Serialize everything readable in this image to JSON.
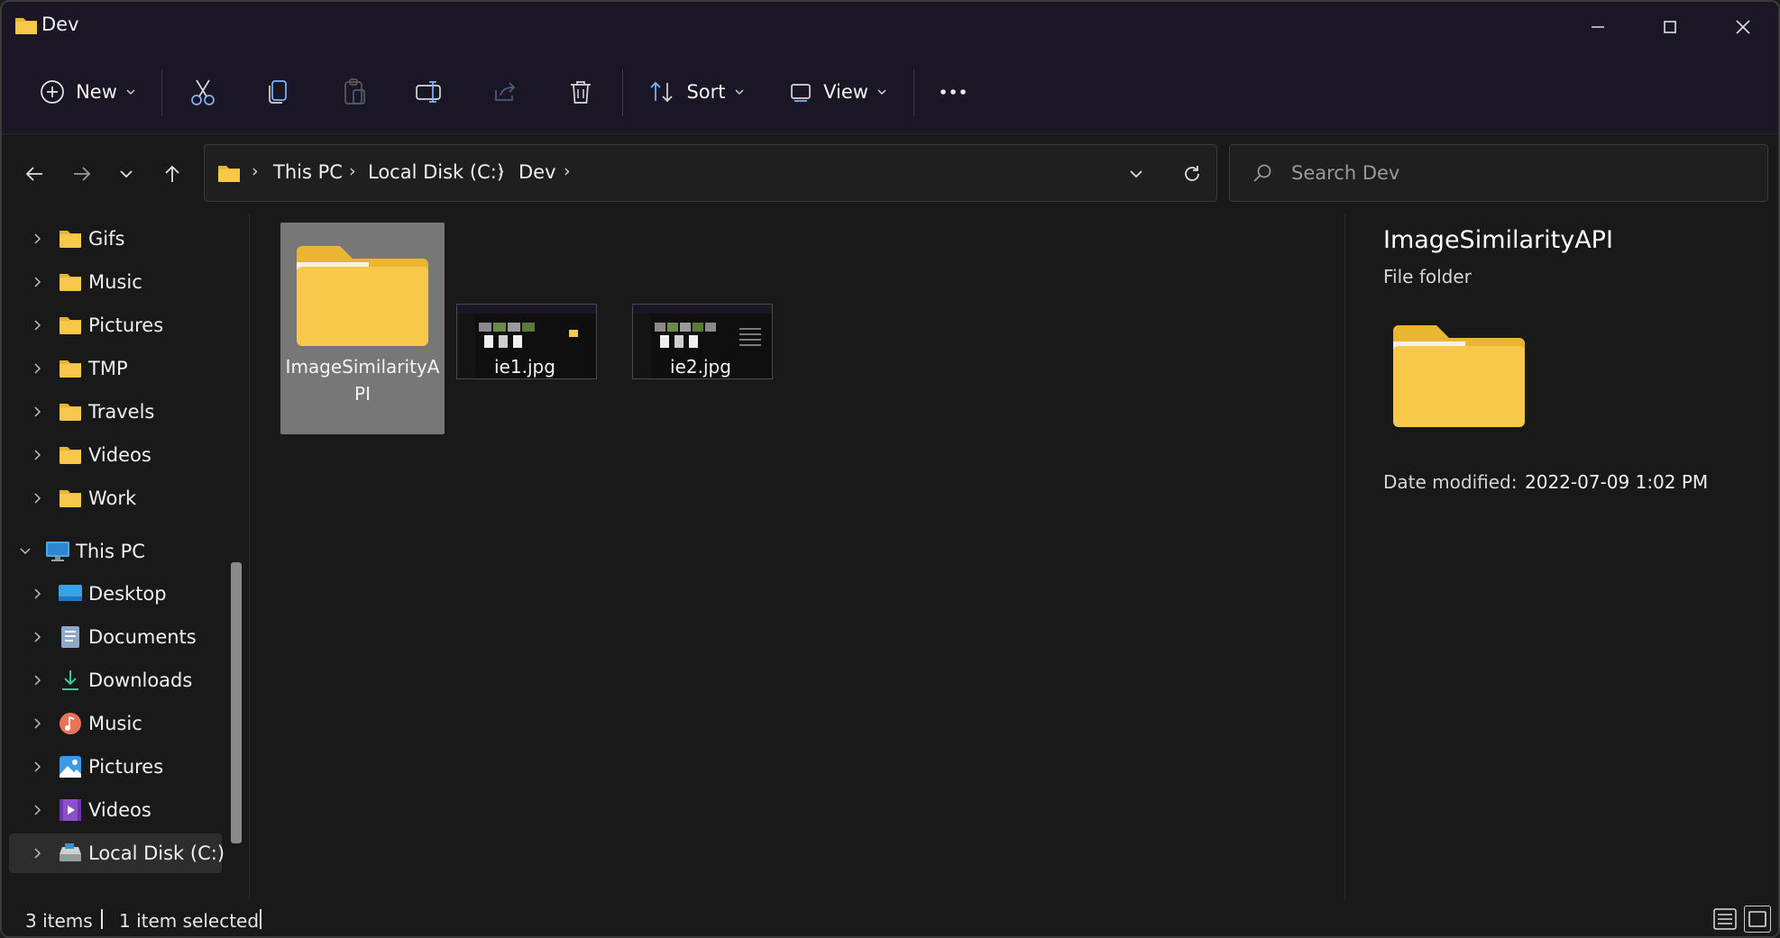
{
  "window": {
    "title": "Dev"
  },
  "commandbar": {
    "new_label": "New",
    "sort_label": "Sort",
    "view_label": "View"
  },
  "address": {
    "crumbs": [
      "This PC",
      "Local Disk (C:)",
      "Dev"
    ]
  },
  "search": {
    "placeholder": "Search Dev"
  },
  "sidebar": {
    "items": [
      {
        "label": "Gifs",
        "icon": "folder-icon"
      },
      {
        "label": "Music",
        "icon": "folder-icon"
      },
      {
        "label": "Pictures",
        "icon": "folder-icon"
      },
      {
        "label": "TMP",
        "icon": "folder-icon"
      },
      {
        "label": "Travels",
        "icon": "folder-icon"
      },
      {
        "label": "Videos",
        "icon": "folder-icon"
      },
      {
        "label": "Work",
        "icon": "folder-icon"
      },
      {
        "label": "This PC",
        "icon": "monitor-icon"
      },
      {
        "label": "Desktop",
        "icon": "desktop-icon"
      },
      {
        "label": "Documents",
        "icon": "documents-icon"
      },
      {
        "label": "Downloads",
        "icon": "download-icon"
      },
      {
        "label": "Music",
        "icon": "music-icon"
      },
      {
        "label": "Pictures",
        "icon": "pictures-icon"
      },
      {
        "label": "Videos",
        "icon": "videos-icon"
      },
      {
        "label": "Local Disk (C:)",
        "icon": "drive-icon"
      }
    ]
  },
  "files": [
    {
      "name_line1": "ImageSimilarityA",
      "name_line2": "PI",
      "type": "folder"
    },
    {
      "name": "ie1.jpg",
      "type": "image"
    },
    {
      "name": "ie2.jpg",
      "type": "image"
    }
  ],
  "details": {
    "name": "ImageSimilarityAPI",
    "type": "File folder",
    "date_label": "Date modified:",
    "date_value": "2022-07-09 1:02 PM"
  },
  "status": {
    "items_count": "3 items",
    "selected": "1 item selected"
  },
  "colors": {
    "folder": "#f8c84a",
    "folder_tab": "#eab531",
    "titlebar": "#1a1626",
    "background": "#191919",
    "selection": "#777777"
  }
}
